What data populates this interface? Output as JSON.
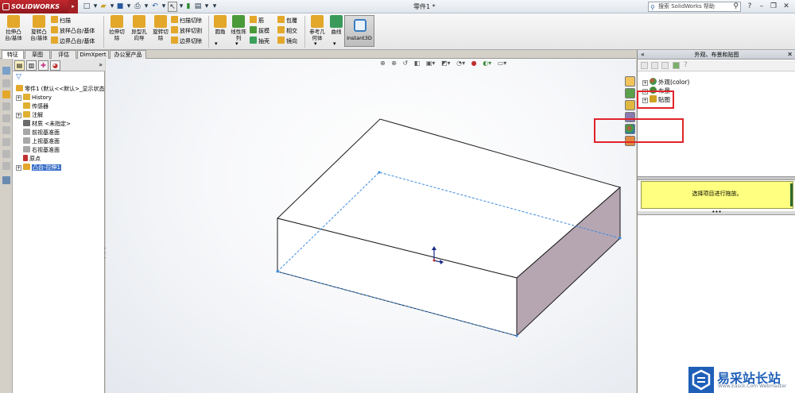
{
  "app": {
    "brand": "SOLIDWORKS",
    "document_title": "零件1 *",
    "search_placeholder": "搜索 SolidWorks 帮助"
  },
  "titlebar": {
    "quick_access": [
      "new-icon",
      "open-icon",
      "save-icon",
      "print-icon",
      "undo-icon",
      "select-icon",
      "traffic-light-icon",
      "options-icon"
    ],
    "window_controls": [
      "help-icon",
      "minimize-icon",
      "restore-icon",
      "close-icon"
    ]
  },
  "ribbon": {
    "big_buttons": [
      {
        "label": "拉伸凸\n台/基体",
        "color": "#e3a72a"
      },
      {
        "label": "旋转凸\n台/基体",
        "color": "#e3a72a"
      },
      {
        "label": "拉伸切\n除",
        "color": "#e3a72a"
      },
      {
        "label": "异型孔\n向导",
        "color": "#e3a72a"
      },
      {
        "label": "旋转切\n除",
        "color": "#e3a72a"
      },
      {
        "label": "圆角",
        "color": "#e3a72a"
      },
      {
        "label": "线性阵\n列",
        "color": "#4a9a3a"
      },
      {
        "label": "参考几\n何体",
        "color": "#e3a72a"
      },
      {
        "label": "曲线",
        "color": "#3a9a5a"
      }
    ],
    "small_buttons_group1": [
      "扫描",
      "放样凸台/基体",
      "边界凸台/基体"
    ],
    "small_buttons_group2": [
      "扫描切除",
      "放样切割",
      "边界切除"
    ],
    "small_buttons_group3": [
      "筋",
      "拔模",
      "抽壳"
    ],
    "small_buttons_group4": [
      "包覆",
      "相交",
      "镜向"
    ],
    "instant3d_label": "Instant3D"
  },
  "tabs": [
    "特征",
    "草图",
    "评估",
    "DimXpert",
    "办公室产品"
  ],
  "active_tab": "特征",
  "feature_tree": {
    "root": "零件1 (默认<<默认>_显示状态",
    "items": [
      {
        "label": "History",
        "expand": "+",
        "icon_color": "#e0b030"
      },
      {
        "label": "传感器",
        "expand": "",
        "icon_color": "#e0b030"
      },
      {
        "label": "注解",
        "expand": "+",
        "icon_color": "#e0b030"
      },
      {
        "label": "材质 <未指定>",
        "expand": "",
        "icon_color": "#6a6a6a"
      },
      {
        "label": "前视基准面",
        "expand": "",
        "icon_color": "#8a8a8a"
      },
      {
        "label": "上视基准面",
        "expand": "",
        "icon_color": "#8a8a8a"
      },
      {
        "label": "右视基准面",
        "expand": "",
        "icon_color": "#8a8a8a"
      },
      {
        "label": "原点",
        "expand": "",
        "icon_color": "#c03030"
      },
      {
        "label": "凸台-拉伸1",
        "expand": "+",
        "icon_color": "#e3a72a",
        "selected": true
      }
    ]
  },
  "viewport": {
    "heads_up_icons": [
      "zoom-fit-icon",
      "zoom-area-icon",
      "previous-view-icon",
      "section-view-icon",
      "view-orientation-icon",
      "display-style-icon",
      "hide-show-icon",
      "edit-appearance-icon",
      "apply-scene-icon",
      "view-settings-icon"
    ]
  },
  "task_pane": {
    "title": "外观、布景和贴图",
    "items": [
      {
        "label": "外观(color)",
        "expand": "+",
        "icon_color": "#d04040"
      },
      {
        "label": "布景",
        "expand": "+",
        "icon_color": "#4a8a3a"
      },
      {
        "label": "贴图",
        "expand": "+",
        "icon_color": "#d0a020"
      }
    ],
    "hint": "选择项目进行拖放。",
    "side_icons": [
      "home-icon",
      "design-library-icon",
      "file-explorer-icon",
      "view-palette-icon",
      "appearances-icon",
      "custom-properties-icon"
    ]
  },
  "watermark": {
    "text": "易采站长站",
    "sub": "Www.Easck.Com   Webmaster"
  }
}
